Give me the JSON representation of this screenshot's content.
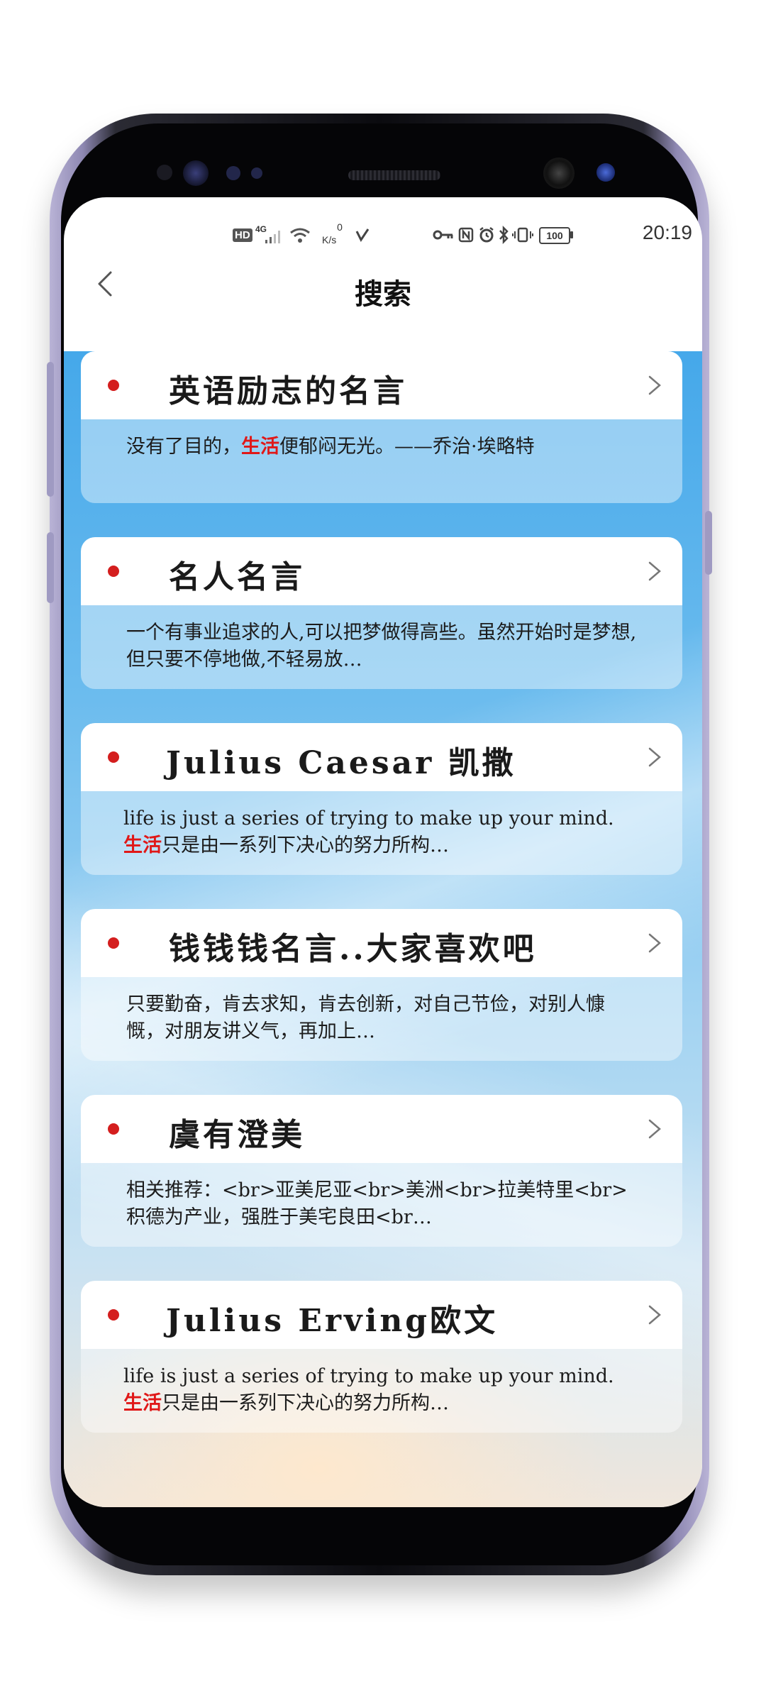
{
  "status_bar": {
    "network_hd": "HD",
    "network_4g": "4G",
    "speed_value": "0",
    "speed_unit": "K/s",
    "battery": "100",
    "time": "20:19"
  },
  "nav": {
    "title": "搜索"
  },
  "cards": [
    {
      "title": "英语励志的名言",
      "text_before": "没有了目的，",
      "highlight": "生活",
      "text_after": "便郁闷无光。——乔治·埃略特"
    },
    {
      "title": "名人名言",
      "text_before": "一个有事业追求的人,可以把梦做得高些。虽然开始时是梦想,但只要不停地做,不轻易放…",
      "highlight": "",
      "text_after": ""
    },
    {
      "title": "Julius Caesar 凯撒",
      "text_before": "life is just a series of trying to make up your mind. ",
      "highlight": "生活",
      "text_after": "只是由一系列下决心的努力所构…"
    },
    {
      "title": "钱钱钱名言..大家喜欢吧",
      "text_before": "只要勤奋，肯去求知，肯去创新，对自己节俭，对别人慷慨，对朋友讲义气，再加上…",
      "highlight": "",
      "text_after": ""
    },
    {
      "title": "虞有澄美",
      "text_before": "相关推荐：<br>亚美尼亚<br>美洲<br>拉美特里<br>积德为产业，强胜于美宅良田<br…",
      "highlight": "",
      "text_after": ""
    },
    {
      "title": "Julius Erving欧文",
      "text_before": "life is just a series of trying to make up your mind. ",
      "highlight": "生活",
      "text_after": "只是由一系列下决心的努力所构…"
    }
  ],
  "colors": {
    "accent_red": "#d41e1e",
    "bg_blue": "#45a8ea"
  },
  "icons": {
    "back": "chevron-left-icon",
    "card_arrow": "chevron-right-icon"
  }
}
